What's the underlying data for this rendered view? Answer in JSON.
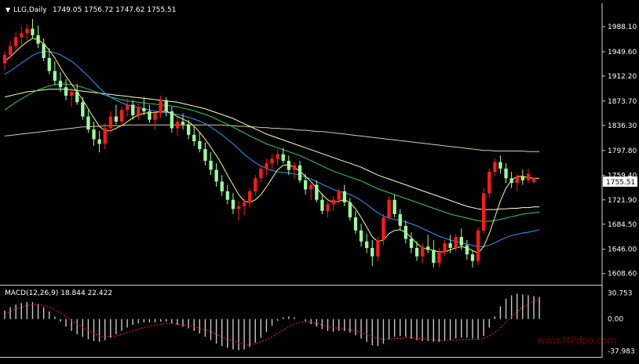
{
  "header": {
    "arrow": "▼",
    "symbol_label": "LLG,Daily",
    "ohlc": "1749.05 1756.72 1747.62 1755.51"
  },
  "price_axis": {
    "ticks": [
      "1988.10",
      "1949.60",
      "1912.20",
      "1873.70",
      "1836.30",
      "1797.80",
      "1759.40",
      "1721.90",
      "1684.50",
      "1646.00",
      "1608.60"
    ],
    "current_price": "1755.51"
  },
  "macd": {
    "label": "MACD(12,26,9) 18.844 22.422",
    "ticks": [
      "30.753",
      "0.00",
      "-37.983"
    ]
  },
  "watermark": {
    "site": "www.MPdpo.com"
  },
  "colors": {
    "background": "#000000",
    "bull_candle": "#ff1a1a",
    "bear_candle": "#9cff9c",
    "ma_fast": "#ffff66",
    "ma_mid": "#3399ff",
    "ma_slow": "#33cc66",
    "ma_longer": "#ffffcc",
    "ma_longest": "#d9cba6",
    "macd_hist": "#c8c8c8",
    "macd_signal": "#ff2222"
  },
  "chart_data": {
    "type": "candlestick",
    "y_range": [
      1595,
      2005
    ],
    "macd_range": [
      -42,
      34
    ],
    "candles": [
      [
        1932,
        1950,
        1922,
        1945
      ],
      [
        1945,
        1966,
        1938,
        1958
      ],
      [
        1958,
        1980,
        1950,
        1972
      ],
      [
        1972,
        1988,
        1960,
        1978
      ],
      [
        1978,
        1992,
        1968,
        1985
      ],
      [
        1985,
        2000,
        1970,
        1975
      ],
      [
        1975,
        1990,
        1955,
        1962
      ],
      [
        1962,
        1970,
        1935,
        1940
      ],
      [
        1940,
        1955,
        1915,
        1920
      ],
      [
        1920,
        1935,
        1898,
        1905
      ],
      [
        1905,
        1918,
        1888,
        1895
      ],
      [
        1895,
        1908,
        1875,
        1882
      ],
      [
        1882,
        1895,
        1865,
        1888
      ],
      [
        1888,
        1900,
        1868,
        1872
      ],
      [
        1872,
        1880,
        1845,
        1850
      ],
      [
        1850,
        1860,
        1825,
        1830
      ],
      [
        1830,
        1842,
        1805,
        1815
      ],
      [
        1815,
        1828,
        1795,
        1808
      ],
      [
        1808,
        1840,
        1800,
        1832
      ],
      [
        1832,
        1858,
        1825,
        1850
      ],
      [
        1850,
        1868,
        1838,
        1842
      ],
      [
        1842,
        1865,
        1835,
        1860
      ],
      [
        1860,
        1878,
        1850,
        1868
      ],
      [
        1868,
        1875,
        1845,
        1852
      ],
      [
        1852,
        1870,
        1845,
        1863
      ],
      [
        1863,
        1880,
        1852,
        1858
      ],
      [
        1858,
        1868,
        1840,
        1845
      ],
      [
        1845,
        1860,
        1830,
        1855
      ],
      [
        1855,
        1882,
        1848,
        1875
      ],
      [
        1875,
        1880,
        1850,
        1858
      ],
      [
        1858,
        1865,
        1825,
        1832
      ],
      [
        1832,
        1848,
        1820,
        1842
      ],
      [
        1842,
        1855,
        1830,
        1838
      ],
      [
        1838,
        1845,
        1815,
        1822
      ],
      [
        1822,
        1835,
        1805,
        1812
      ],
      [
        1812,
        1825,
        1795,
        1800
      ],
      [
        1800,
        1810,
        1775,
        1782
      ],
      [
        1782,
        1795,
        1760,
        1768
      ],
      [
        1768,
        1778,
        1742,
        1750
      ],
      [
        1750,
        1760,
        1728,
        1735
      ],
      [
        1735,
        1745,
        1715,
        1722
      ],
      [
        1722,
        1732,
        1700,
        1708
      ],
      [
        1708,
        1720,
        1690,
        1712
      ],
      [
        1712,
        1725,
        1698,
        1718
      ],
      [
        1718,
        1740,
        1710,
        1735
      ],
      [
        1735,
        1760,
        1728,
        1755
      ],
      [
        1755,
        1775,
        1748,
        1770
      ],
      [
        1770,
        1785,
        1760,
        1778
      ],
      [
        1778,
        1792,
        1768,
        1785
      ],
      [
        1785,
        1800,
        1775,
        1792
      ],
      [
        1792,
        1802,
        1778,
        1782
      ],
      [
        1782,
        1790,
        1760,
        1768
      ],
      [
        1768,
        1780,
        1755,
        1775
      ],
      [
        1775,
        1782,
        1748,
        1752
      ],
      [
        1752,
        1762,
        1730,
        1738
      ],
      [
        1738,
        1750,
        1722,
        1745
      ],
      [
        1745,
        1752,
        1718,
        1722
      ],
      [
        1722,
        1732,
        1700,
        1705
      ],
      [
        1705,
        1720,
        1695,
        1715
      ],
      [
        1715,
        1728,
        1705,
        1722
      ],
      [
        1722,
        1740,
        1715,
        1735
      ],
      [
        1735,
        1745,
        1712,
        1718
      ],
      [
        1718,
        1725,
        1690,
        1695
      ],
      [
        1695,
        1705,
        1670,
        1675
      ],
      [
        1675,
        1685,
        1650,
        1658
      ],
      [
        1658,
        1670,
        1640,
        1648
      ],
      [
        1648,
        1660,
        1620,
        1635
      ],
      [
        1635,
        1665,
        1628,
        1660
      ],
      [
        1660,
        1700,
        1652,
        1695
      ],
      [
        1695,
        1728,
        1690,
        1722
      ],
      [
        1722,
        1730,
        1695,
        1700
      ],
      [
        1700,
        1708,
        1675,
        1682
      ],
      [
        1682,
        1690,
        1655,
        1662
      ],
      [
        1662,
        1672,
        1640,
        1648
      ],
      [
        1648,
        1658,
        1628,
        1635
      ],
      [
        1635,
        1655,
        1625,
        1650
      ],
      [
        1650,
        1668,
        1640,
        1645
      ],
      [
        1645,
        1660,
        1618,
        1625
      ],
      [
        1625,
        1648,
        1618,
        1642
      ],
      [
        1642,
        1660,
        1635,
        1655
      ],
      [
        1655,
        1668,
        1640,
        1648
      ],
      [
        1648,
        1670,
        1642,
        1665
      ],
      [
        1665,
        1678,
        1645,
        1652
      ],
      [
        1652,
        1660,
        1630,
        1638
      ],
      [
        1638,
        1645,
        1618,
        1628
      ],
      [
        1628,
        1680,
        1622,
        1675
      ],
      [
        1675,
        1740,
        1670,
        1732
      ],
      [
        1732,
        1770,
        1725,
        1765
      ],
      [
        1765,
        1785,
        1758,
        1780
      ],
      [
        1780,
        1790,
        1762,
        1770
      ],
      [
        1770,
        1778,
        1748,
        1755
      ],
      [
        1755,
        1765,
        1740,
        1748
      ],
      [
        1748,
        1762,
        1735,
        1758
      ],
      [
        1758,
        1768,
        1745,
        1752
      ],
      [
        1752,
        1770,
        1748,
        1762
      ],
      [
        1749.05,
        1756.72,
        1747.62,
        1755.51
      ]
    ],
    "ma_fast": [
      1935,
      1942,
      1950,
      1958,
      1965,
      1970,
      1968,
      1962,
      1952,
      1940,
      1925,
      1912,
      1900,
      1888,
      1876,
      1862,
      1848,
      1835,
      1828,
      1828,
      1832,
      1836,
      1842,
      1848,
      1852,
      1855,
      1856,
      1856,
      1858,
      1858,
      1855,
      1850,
      1846,
      1842,
      1835,
      1826,
      1815,
      1803,
      1790,
      1776,
      1760,
      1745,
      1730,
      1720,
      1718,
      1722,
      1730,
      1742,
      1755,
      1768,
      1775,
      1776,
      1772,
      1766,
      1758,
      1750,
      1740,
      1730,
      1722,
      1718,
      1720,
      1722,
      1718,
      1708,
      1695,
      1680,
      1665,
      1658,
      1660,
      1670,
      1675,
      1676,
      1672,
      1664,
      1655,
      1648,
      1646,
      1644,
      1642,
      1642,
      1645,
      1648,
      1650,
      1648,
      1644,
      1640,
      1650,
      1670,
      1695,
      1720,
      1740,
      1752,
      1758,
      1758,
      1756,
      1755,
      1755
    ],
    "ma_mid": [
      1915,
      1920,
      1926,
      1932,
      1938,
      1944,
      1948,
      1950,
      1950,
      1948,
      1945,
      1940,
      1935,
      1928,
      1920,
      1912,
      1903,
      1894,
      1886,
      1880,
      1875,
      1871,
      1868,
      1866,
      1864,
      1862,
      1860,
      1858,
      1857,
      1856,
      1855,
      1853,
      1851,
      1849,
      1846,
      1843,
      1839,
      1834,
      1828,
      1822,
      1815,
      1808,
      1800,
      1792,
      1785,
      1779,
      1774,
      1770,
      1767,
      1765,
      1764,
      1763,
      1762,
      1760,
      1757,
      1754,
      1750,
      1746,
      1742,
      1738,
      1735,
      1733,
      1730,
      1726,
      1721,
      1715,
      1708,
      1702,
      1697,
      1694,
      1692,
      1690,
      1688,
      1685,
      1682,
      1678,
      1674,
      1670,
      1666,
      1663,
      1660,
      1658,
      1656,
      1654,
      1652,
      1650,
      1650,
      1652,
      1656,
      1660,
      1664,
      1667,
      1669,
      1671,
      1672,
      1674,
      1676
    ],
    "ma_slow": [
      1860,
      1866,
      1872,
      1877,
      1882,
      1887,
      1891,
      1894,
      1897,
      1899,
      1900,
      1900,
      1899,
      1897,
      1895,
      1892,
      1889,
      1886,
      1883,
      1880,
      1878,
      1876,
      1874,
      1873,
      1872,
      1871,
      1870,
      1869,
      1868,
      1867,
      1866,
      1865,
      1863,
      1861,
      1859,
      1856,
      1853,
      1850,
      1846,
      1842,
      1838,
      1834,
      1829,
      1825,
      1820,
      1816,
      1812,
      1808,
      1805,
      1802,
      1799,
      1796,
      1793,
      1790,
      1786,
      1782,
      1778,
      1774,
      1770,
      1766,
      1763,
      1760,
      1757,
      1754,
      1751,
      1747,
      1743,
      1739,
      1736,
      1733,
      1730,
      1727,
      1724,
      1721,
      1718,
      1715,
      1712,
      1709,
      1706,
      1703,
      1700,
      1698,
      1696,
      1694,
      1692,
      1690,
      1689,
      1689,
      1690,
      1692,
      1694,
      1696,
      1698,
      1700,
      1701,
      1702,
      1703
    ],
    "ma_longer": [
      1880,
      1882,
      1884,
      1886,
      1888,
      1889,
      1890,
      1891,
      1892,
      1892,
      1892,
      1892,
      1891,
      1890,
      1889,
      1888,
      1887,
      1886,
      1885,
      1884,
      1883,
      1882,
      1881,
      1880,
      1879,
      1878,
      1877,
      1876,
      1875,
      1874,
      1873,
      1872,
      1870,
      1868,
      1866,
      1864,
      1862,
      1859,
      1856,
      1853,
      1850,
      1847,
      1843,
      1839,
      1835,
      1831,
      1827,
      1823,
      1820,
      1817,
      1814,
      1811,
      1808,
      1805,
      1802,
      1799,
      1796,
      1793,
      1790,
      1787,
      1784,
      1781,
      1778,
      1775,
      1772,
      1768,
      1764,
      1760,
      1757,
      1754,
      1751,
      1748,
      1745,
      1742,
      1739,
      1736,
      1733,
      1730,
      1727,
      1724,
      1721,
      1718,
      1715,
      1712,
      1710,
      1708,
      1707,
      1707,
      1707,
      1708,
      1708,
      1709,
      1709,
      1710,
      1710,
      1711,
      1711
    ],
    "ma_longest": [
      1820,
      1821,
      1822,
      1823,
      1824,
      1825,
      1826,
      1827,
      1828,
      1829,
      1830,
      1831,
      1832,
      1833,
      1834,
      1834,
      1835,
      1835,
      1836,
      1836,
      1836,
      1836,
      1837,
      1837,
      1837,
      1837,
      1837,
      1837,
      1837,
      1837,
      1837,
      1837,
      1837,
      1837,
      1837,
      1837,
      1837,
      1837,
      1837,
      1837,
      1836,
      1836,
      1835,
      1835,
      1834,
      1834,
      1833,
      1833,
      1832,
      1832,
      1831,
      1831,
      1830,
      1829,
      1829,
      1828,
      1827,
      1827,
      1826,
      1825,
      1824,
      1823,
      1822,
      1821,
      1820,
      1819,
      1818,
      1817,
      1816,
      1815,
      1814,
      1813,
      1812,
      1811,
      1810,
      1809,
      1808,
      1807,
      1806,
      1805,
      1804,
      1803,
      1802,
      1801,
      1800,
      1799,
      1798,
      1798,
      1797,
      1797,
      1797,
      1797,
      1797,
      1797,
      1796,
      1796,
      1796
    ],
    "macd_hist": [
      10,
      14,
      17,
      19,
      20,
      20,
      18,
      14,
      9,
      3,
      -3,
      -9,
      -14,
      -18,
      -21,
      -24,
      -26,
      -27,
      -25,
      -22,
      -18,
      -14,
      -10,
      -7,
      -5,
      -4,
      -4,
      -4,
      -3,
      -3,
      -5,
      -7,
      -9,
      -11,
      -14,
      -17,
      -21,
      -25,
      -29,
      -32,
      -34,
      -36,
      -37,
      -36,
      -33,
      -28,
      -22,
      -15,
      -8,
      -2,
      2,
      3,
      2,
      0,
      -3,
      -6,
      -9,
      -12,
      -14,
      -15,
      -14,
      -14,
      -16,
      -19,
      -23,
      -27,
      -31,
      -32,
      -29,
      -24,
      -21,
      -20,
      -21,
      -23,
      -25,
      -26,
      -26,
      -27,
      -27,
      -26,
      -25,
      -23,
      -22,
      -22,
      -23,
      -24,
      -20,
      -10,
      3,
      15,
      24,
      28,
      30,
      29,
      28,
      27,
      26
    ],
    "macd_signal": [
      6,
      9,
      12,
      14,
      16,
      17,
      17,
      16,
      14,
      11,
      7,
      3,
      -2,
      -6,
      -10,
      -14,
      -17,
      -20,
      -21,
      -21,
      -20,
      -18,
      -16,
      -14,
      -12,
      -10,
      -8,
      -7,
      -6,
      -5,
      -5,
      -6,
      -7,
      -8,
      -9,
      -11,
      -13,
      -15,
      -18,
      -21,
      -24,
      -26,
      -28,
      -30,
      -30,
      -29,
      -27,
      -24,
      -21,
      -17,
      -13,
      -9,
      -6,
      -4,
      -3,
      -4,
      -5,
      -7,
      -9,
      -10,
      -11,
      -12,
      -13,
      -14,
      -16,
      -18,
      -21,
      -23,
      -24,
      -24,
      -23,
      -23,
      -22,
      -22,
      -23,
      -23,
      -24,
      -24,
      -25,
      -25,
      -25,
      -25,
      -24,
      -24,
      -24,
      -24,
      -23,
      -20,
      -16,
      -10,
      -4,
      3,
      9,
      14,
      18,
      21,
      22.4
    ]
  }
}
